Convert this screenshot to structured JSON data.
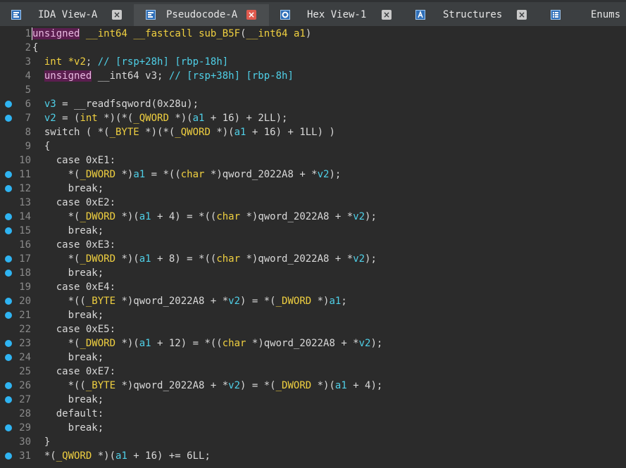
{
  "tabs": [
    {
      "label": "IDA View-A",
      "icon": "ida-view-icon",
      "active": false
    },
    {
      "label": "Pseudocode-A",
      "icon": "pseudocode-icon",
      "active": true
    },
    {
      "label": "Hex View-1",
      "icon": "hex-view-icon",
      "active": false
    },
    {
      "label": "Structures",
      "icon": "structures-icon",
      "active": false
    },
    {
      "label": "Enums",
      "icon": "enums-icon",
      "active": false
    }
  ],
  "close_glyph": "×",
  "lines": [
    {
      "n": "1",
      "bp": false,
      "segs": [
        [
          "unsigned",
          "kwu"
        ],
        [
          " ",
          ""
        ],
        [
          "__int64",
          "ty"
        ],
        [
          " ",
          ""
        ],
        [
          "__fastcall",
          "ty"
        ],
        [
          " ",
          ""
        ],
        [
          "sub_B5F",
          "ty"
        ],
        [
          "(",
          ""
        ],
        [
          "__int64",
          "ty"
        ],
        [
          " ",
          ""
        ],
        [
          "a1",
          "ty"
        ],
        [
          ")",
          ""
        ]
      ]
    },
    {
      "n": "2",
      "bp": false,
      "segs": [
        [
          "{",
          ""
        ]
      ]
    },
    {
      "n": "3",
      "bp": false,
      "segs": [
        [
          "  ",
          ""
        ],
        [
          "int",
          "ty"
        ],
        [
          " ",
          ""
        ],
        [
          "*v2",
          "ty"
        ],
        [
          "; ",
          ""
        ],
        [
          "// [rsp+28h] [rbp-18h]",
          "cm"
        ]
      ]
    },
    {
      "n": "4",
      "bp": false,
      "segs": [
        [
          "  ",
          ""
        ],
        [
          "unsigned",
          "kwu"
        ],
        [
          " __int64 v3; ",
          ""
        ],
        [
          "// [rsp+38h] [rbp-8h]",
          "cm"
        ]
      ]
    },
    {
      "n": "5",
      "bp": false,
      "segs": [
        [
          "",
          ""
        ]
      ]
    },
    {
      "n": "6",
      "bp": true,
      "segs": [
        [
          "  ",
          ""
        ],
        [
          "v3",
          "var"
        ],
        [
          " = __readfsqword(0x28u);",
          ""
        ]
      ]
    },
    {
      "n": "7",
      "bp": true,
      "segs": [
        [
          "  ",
          ""
        ],
        [
          "v2",
          "var"
        ],
        [
          " = (",
          ""
        ],
        [
          "int",
          "ty"
        ],
        [
          " *)(*(",
          ""
        ],
        [
          "_QWORD",
          "ty"
        ],
        [
          " *)(",
          ""
        ],
        [
          "a1",
          "var"
        ],
        [
          " + 16) + 2LL);",
          ""
        ]
      ]
    },
    {
      "n": "8",
      "bp": false,
      "segs": [
        [
          "  switch ( *(",
          ""
        ],
        [
          "_BYTE",
          "ty"
        ],
        [
          " *)(*(",
          ""
        ],
        [
          "_QWORD",
          "ty"
        ],
        [
          " *)(",
          ""
        ],
        [
          "a1",
          "var"
        ],
        [
          " + 16) + 1LL) )",
          ""
        ]
      ]
    },
    {
      "n": "9",
      "bp": false,
      "segs": [
        [
          "  {",
          ""
        ]
      ]
    },
    {
      "n": "10",
      "bp": false,
      "segs": [
        [
          "    case 0xE1:",
          ""
        ]
      ]
    },
    {
      "n": "11",
      "bp": true,
      "segs": [
        [
          "      *(",
          ""
        ],
        [
          "_DWORD",
          "ty"
        ],
        [
          " *)",
          ""
        ],
        [
          "a1",
          "var"
        ],
        [
          " = *((",
          ""
        ],
        [
          "char",
          "ty"
        ],
        [
          " *)qword_2022A8 + *",
          ""
        ],
        [
          "v2",
          "var"
        ],
        [
          ");",
          ""
        ]
      ]
    },
    {
      "n": "12",
      "bp": true,
      "segs": [
        [
          "      break;",
          ""
        ]
      ]
    },
    {
      "n": "13",
      "bp": false,
      "segs": [
        [
          "    case 0xE2:",
          ""
        ]
      ]
    },
    {
      "n": "14",
      "bp": true,
      "segs": [
        [
          "      *(",
          ""
        ],
        [
          "_DWORD",
          "ty"
        ],
        [
          " *)(",
          ""
        ],
        [
          "a1",
          "var"
        ],
        [
          " + 4) = *((",
          ""
        ],
        [
          "char",
          "ty"
        ],
        [
          " *)qword_2022A8 + *",
          ""
        ],
        [
          "v2",
          "var"
        ],
        [
          ");",
          ""
        ]
      ]
    },
    {
      "n": "15",
      "bp": true,
      "segs": [
        [
          "      break;",
          ""
        ]
      ]
    },
    {
      "n": "16",
      "bp": false,
      "segs": [
        [
          "    case 0xE3:",
          ""
        ]
      ]
    },
    {
      "n": "17",
      "bp": true,
      "segs": [
        [
          "      *(",
          ""
        ],
        [
          "_DWORD",
          "ty"
        ],
        [
          " *)(",
          ""
        ],
        [
          "a1",
          "var"
        ],
        [
          " + 8) = *((",
          ""
        ],
        [
          "char",
          "ty"
        ],
        [
          " *)qword_2022A8 + *",
          ""
        ],
        [
          "v2",
          "var"
        ],
        [
          ");",
          ""
        ]
      ]
    },
    {
      "n": "18",
      "bp": true,
      "segs": [
        [
          "      break;",
          ""
        ]
      ]
    },
    {
      "n": "19",
      "bp": false,
      "segs": [
        [
          "    case 0xE4:",
          ""
        ]
      ]
    },
    {
      "n": "20",
      "bp": true,
      "segs": [
        [
          "      *((",
          ""
        ],
        [
          "_BYTE",
          "ty"
        ],
        [
          " *)qword_2022A8 + *",
          ""
        ],
        [
          "v2",
          "var"
        ],
        [
          ") = *(",
          ""
        ],
        [
          "_DWORD",
          "ty"
        ],
        [
          " *)",
          ""
        ],
        [
          "a1",
          "var"
        ],
        [
          ";",
          ""
        ]
      ]
    },
    {
      "n": "21",
      "bp": true,
      "segs": [
        [
          "      break;",
          ""
        ]
      ]
    },
    {
      "n": "22",
      "bp": false,
      "segs": [
        [
          "    case 0xE5:",
          ""
        ]
      ]
    },
    {
      "n": "23",
      "bp": true,
      "segs": [
        [
          "      *(",
          ""
        ],
        [
          "_DWORD",
          "ty"
        ],
        [
          " *)(",
          ""
        ],
        [
          "a1",
          "var"
        ],
        [
          " + 12) = *((",
          ""
        ],
        [
          "char",
          "ty"
        ],
        [
          " *)qword_2022A8 + *",
          ""
        ],
        [
          "v2",
          "var"
        ],
        [
          ");",
          ""
        ]
      ]
    },
    {
      "n": "24",
      "bp": true,
      "segs": [
        [
          "      break;",
          ""
        ]
      ]
    },
    {
      "n": "25",
      "bp": false,
      "segs": [
        [
          "    case 0xE7:",
          ""
        ]
      ]
    },
    {
      "n": "26",
      "bp": true,
      "segs": [
        [
          "      *((",
          ""
        ],
        [
          "_BYTE",
          "ty"
        ],
        [
          " *)qword_2022A8 + *",
          ""
        ],
        [
          "v2",
          "var"
        ],
        [
          ") = *(",
          ""
        ],
        [
          "_DWORD",
          "ty"
        ],
        [
          " *)(",
          ""
        ],
        [
          "a1",
          "var"
        ],
        [
          " + 4);",
          ""
        ]
      ]
    },
    {
      "n": "27",
      "bp": true,
      "segs": [
        [
          "      break;",
          ""
        ]
      ]
    },
    {
      "n": "28",
      "bp": false,
      "segs": [
        [
          "    default:",
          ""
        ]
      ]
    },
    {
      "n": "29",
      "bp": true,
      "segs": [
        [
          "      break;",
          ""
        ]
      ]
    },
    {
      "n": "30",
      "bp": false,
      "segs": [
        [
          "  }",
          ""
        ]
      ]
    },
    {
      "n": "31",
      "bp": true,
      "segs": [
        [
          "  *(",
          ""
        ],
        [
          "_QWORD",
          "ty"
        ],
        [
          " *)(",
          ""
        ],
        [
          "a1",
          "var"
        ],
        [
          " + 16) += 6LL;",
          ""
        ]
      ]
    }
  ]
}
